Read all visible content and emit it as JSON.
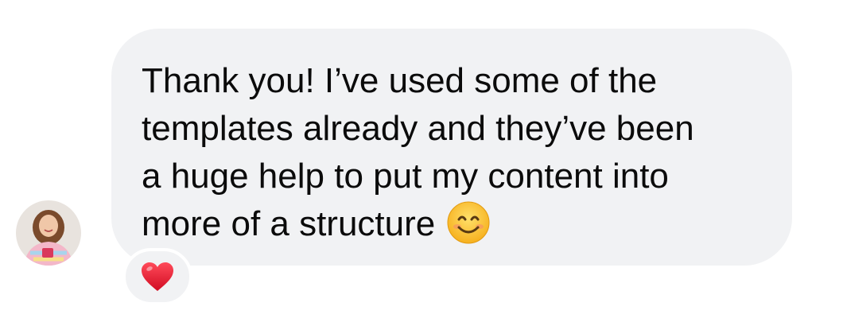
{
  "message": {
    "lines": [
      "Thank you! I’ve used some of the",
      "templates already and they’ve been",
      "a huge help to put my content into",
      "more of a structure"
    ],
    "emoji": "smiling-face-with-smiling-eyes"
  },
  "reaction": {
    "emoji": "red-heart"
  },
  "colors": {
    "bubble": "#f1f2f4",
    "text": "#0b0b0b",
    "heart": "#e0102a"
  }
}
